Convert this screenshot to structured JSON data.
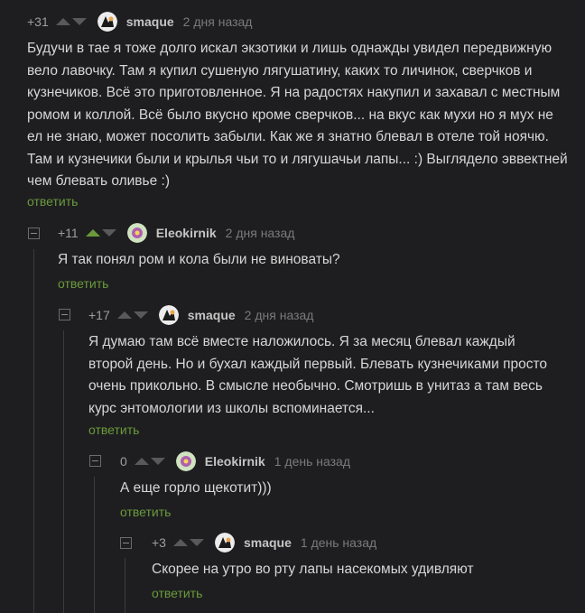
{
  "comments": [
    {
      "score": "+31",
      "upvoted": false,
      "author": "smaque",
      "avatar": "smaque",
      "date": "2 дня назад",
      "text": "Будучи в тае я тоже долго искал экзотики и лишь однажды увидел передвижную вело лавочку. Там я купил сушеную лягушатину, каких то личинок, сверчков и кузнечиков. Всё это приготовленное. Я на радостях накупил и захавал с местным ромом и коллой. Всё было вкусно кроме сверчков... на вкус как мухи но я мух не ел не знаю, может посолить забыли. Как же я знатно блевал в отеле той ноячю. Там и кузнечики были и крылья чьи то и лягушачьи лапы... :) Выглядело эввектней чем блевать оливье :)",
      "reply": "ответить"
    },
    {
      "score": "+11",
      "upvoted": true,
      "author": "Eleokirnik",
      "avatar": "eleokirnik",
      "date": "2 дня назад",
      "text": "Я так понял ром и кола были не виноваты?",
      "reply": "ответить"
    },
    {
      "score": "+17",
      "upvoted": false,
      "author": "smaque",
      "avatar": "smaque",
      "date": "2 дня назад",
      "text": "Я думаю там всё вместе наложилось. Я за месяц блевал каждый второй день. Но и бухал каждый первый. Блевать кузнечиками просто очень прикольно. В смысле необычно. Смотришь в унитаз а там весь курс энтомологии из школы вспоминается...",
      "reply": "ответить"
    },
    {
      "score": "0",
      "upvoted": false,
      "author": "Eleokirnik",
      "avatar": "eleokirnik",
      "date": "1 день назад",
      "text": "А еще горло щекотит)))",
      "reply": "ответить"
    },
    {
      "score": "+3",
      "upvoted": false,
      "author": "smaque",
      "avatar": "smaque",
      "date": "1 день назад",
      "text": "Скорее на утро во рту лапы насекомых удивляют",
      "reply": "ответить"
    }
  ],
  "colors": {
    "background": "#1e1e20",
    "text": "#d6d6d6",
    "reply": "#6a9a3c",
    "muted": "#7a7a7a",
    "upvote_active": "#6a9a3c"
  }
}
